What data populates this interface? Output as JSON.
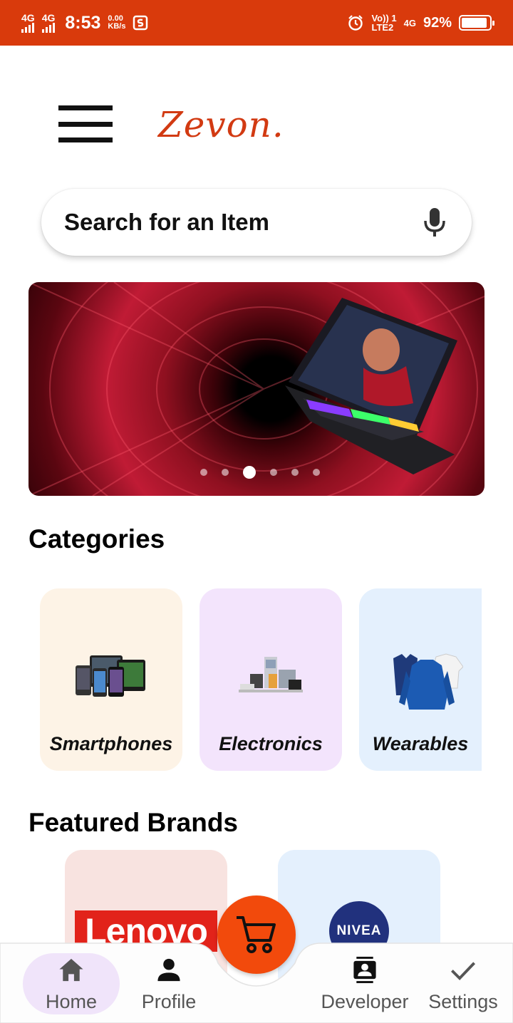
{
  "status_bar": {
    "network_1": "4G",
    "network_2": "4G",
    "time": "8:53",
    "speed_value": "0.00",
    "speed_unit": "KB/s",
    "volte_top": "Vo)) 1",
    "volte_bottom": "LTE2",
    "network_3": "4G",
    "battery_percent": "92%",
    "battery_level": 0.92
  },
  "colors": {
    "status_bar": "#d93a0c",
    "brand": "#d23a12",
    "cart_fab": "#f24a0c",
    "nav_active_bg": "#f0e4fa"
  },
  "header": {
    "menu_icon": "hamburger-menu-icon",
    "logo_text": "Zevon."
  },
  "search": {
    "placeholder": "Search for an Item",
    "mic_icon": "microphone-icon"
  },
  "banner": {
    "slide_count": 6,
    "active_slide": 3
  },
  "categories": {
    "title": "Categories",
    "items": [
      {
        "label": "Smartphones",
        "bg": "#fdf3e6"
      },
      {
        "label": "Electronics",
        "bg": "#f3e4fc"
      },
      {
        "label": "Wearables",
        "bg": "#e4f0fd"
      }
    ]
  },
  "featured_brands": {
    "title": "Featured Brands",
    "items": [
      {
        "logo_text": "Lenovo",
        "bg": "#f8e3e0"
      },
      {
        "logo_text": "NIVEA",
        "bg": "#e4f0fd"
      }
    ]
  },
  "bottom_nav": {
    "items": [
      {
        "label": "Home",
        "icon": "home-icon",
        "active": true
      },
      {
        "label": "Profile",
        "icon": "person-icon",
        "active": false
      },
      {
        "label": "Developer",
        "icon": "contact-card-icon",
        "active": false
      },
      {
        "label": "Settings",
        "icon": "checkmark-icon",
        "active": false
      }
    ],
    "fab_icon": "shopping-cart-icon"
  }
}
